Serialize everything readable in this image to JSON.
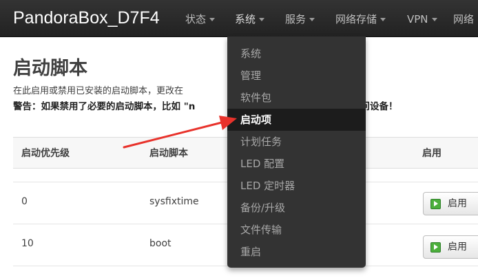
{
  "navbar": {
    "brand": "PandoraBox_D7F4",
    "items": [
      {
        "label": "状态"
      },
      {
        "label": "系统"
      },
      {
        "label": "服务"
      },
      {
        "label": "网络存储"
      },
      {
        "label": "VPN"
      },
      {
        "label": "网络"
      }
    ]
  },
  "dropdown": {
    "items": [
      {
        "label": "系统"
      },
      {
        "label": "管理"
      },
      {
        "label": "软件包"
      },
      {
        "label": "启动项"
      },
      {
        "label": "计划任务"
      },
      {
        "label": "LED 配置"
      },
      {
        "label": "LED 定时器"
      },
      {
        "label": "备份/升级"
      },
      {
        "label": "文件传输"
      },
      {
        "label": "重启"
      }
    ],
    "active_index": 3
  },
  "page": {
    "title": "启动脚本",
    "description_start": "在此启用或禁用已安装的启动脚本，更改在",
    "warning_start": "警告：如果禁用了必要的启动脚本，比如 \"n",
    "warning_end": "访问设备！"
  },
  "table": {
    "headers": {
      "priority": "启动优先级",
      "script": "启动脚本",
      "enable": "启用"
    },
    "rows": [
      {
        "priority": "0",
        "script": "sysfixtime",
        "button": "启用"
      },
      {
        "priority": "10",
        "script": "boot",
        "button": "启用"
      }
    ]
  },
  "colors": {
    "navbar": "#222222",
    "dropdown": "#333333",
    "arrow": "#e8322b",
    "enable_icon": "#4caf3c"
  }
}
